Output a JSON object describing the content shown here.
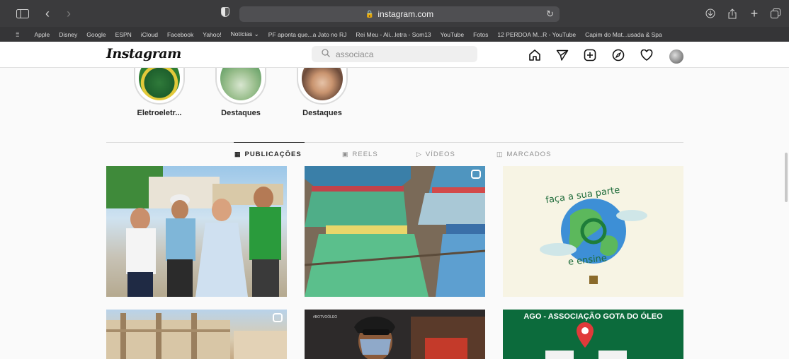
{
  "browser": {
    "url": "instagram.com",
    "bookmarks": [
      "Apple",
      "Disney",
      "Google",
      "ESPN",
      "iCloud",
      "Facebook",
      "Yahoo!",
      "Notícias ⌄",
      "PF aponta que...a Jato no RJ",
      "Rei Meu - Ali...letra - Som13",
      "YouTube",
      "Fotos",
      "12 PERDOA M...R - YouTube",
      "Capim do Mat...usada & Spa"
    ]
  },
  "instagram": {
    "logo": "Instagram",
    "search_value": "associaca",
    "highlights": [
      {
        "label": "Eletroeletr..."
      },
      {
        "label": "Destaques"
      },
      {
        "label": "Destaques"
      }
    ],
    "tabs": [
      {
        "label": "PUBLICAÇÕES",
        "icon": "grid-icon"
      },
      {
        "label": "REELS",
        "icon": "reels-icon"
      },
      {
        "label": "VÍDEOS",
        "icon": "play-icon"
      },
      {
        "label": "MARCADOS",
        "icon": "tagged-icon"
      }
    ],
    "posts": {
      "p3_top": "faça a sua parte",
      "p3_bottom": "e ensine",
      "p6_title": "AGO - ASSOCIAÇÃO GOTA DO ÓLEO",
      "p5_tag": "#BOTVOÓLEO"
    }
  },
  "colors": {
    "toolbar": "#3b3b3d",
    "bookmarks": "#353537",
    "ig_green": "#0c6b3c"
  }
}
